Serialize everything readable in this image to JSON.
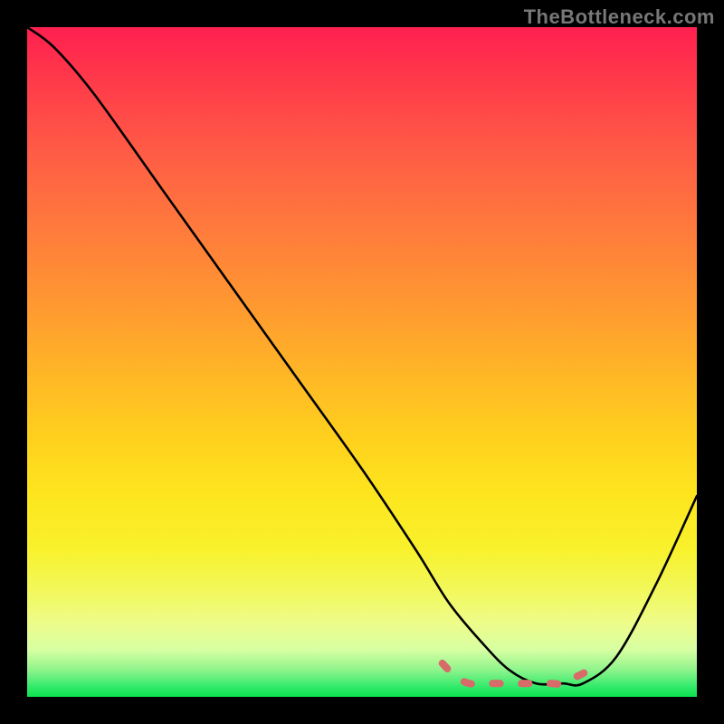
{
  "watermark": "TheBottleneck.com",
  "chart_data": {
    "type": "line",
    "title": "",
    "xlabel": "",
    "ylabel": "",
    "xlim": [
      0,
      100
    ],
    "ylim": [
      0,
      100
    ],
    "gradient_stops": [
      {
        "pct": 0,
        "color": "#ff1f50"
      },
      {
        "pct": 8,
        "color": "#ff3a4a"
      },
      {
        "pct": 18,
        "color": "#ff5a46"
      },
      {
        "pct": 30,
        "color": "#ff7a3c"
      },
      {
        "pct": 42,
        "color": "#ff9a30"
      },
      {
        "pct": 52,
        "color": "#ffb726"
      },
      {
        "pct": 62,
        "color": "#ffd21d"
      },
      {
        "pct": 70,
        "color": "#fde61e"
      },
      {
        "pct": 78,
        "color": "#f8f12c"
      },
      {
        "pct": 84,
        "color": "#f2f85a"
      },
      {
        "pct": 89,
        "color": "#eefc8a"
      },
      {
        "pct": 93,
        "color": "#d7ffa3"
      },
      {
        "pct": 96,
        "color": "#8ef48c"
      },
      {
        "pct": 98.5,
        "color": "#32ea6a"
      },
      {
        "pct": 100,
        "color": "#0de24e"
      }
    ],
    "series": [
      {
        "name": "bottleneck-curve",
        "color": "#000000",
        "x": [
          0,
          4,
          10,
          20,
          30,
          40,
          50,
          58,
          63,
          68,
          72,
          76,
          80,
          83,
          88,
          94,
          100
        ],
        "y": [
          100,
          97,
          90,
          76,
          62,
          48,
          34,
          22,
          14,
          8,
          4,
          2,
          2,
          2,
          6,
          17,
          30
        ]
      },
      {
        "name": "flat-bottom-marker",
        "color": "#d86a6a",
        "x": [
          62,
          64,
          66,
          68,
          70,
          72,
          74,
          76,
          78,
          80,
          82,
          84
        ],
        "y": [
          5,
          3,
          2,
          2,
          2,
          2,
          2,
          2,
          2,
          2,
          3,
          4
        ]
      }
    ]
  }
}
